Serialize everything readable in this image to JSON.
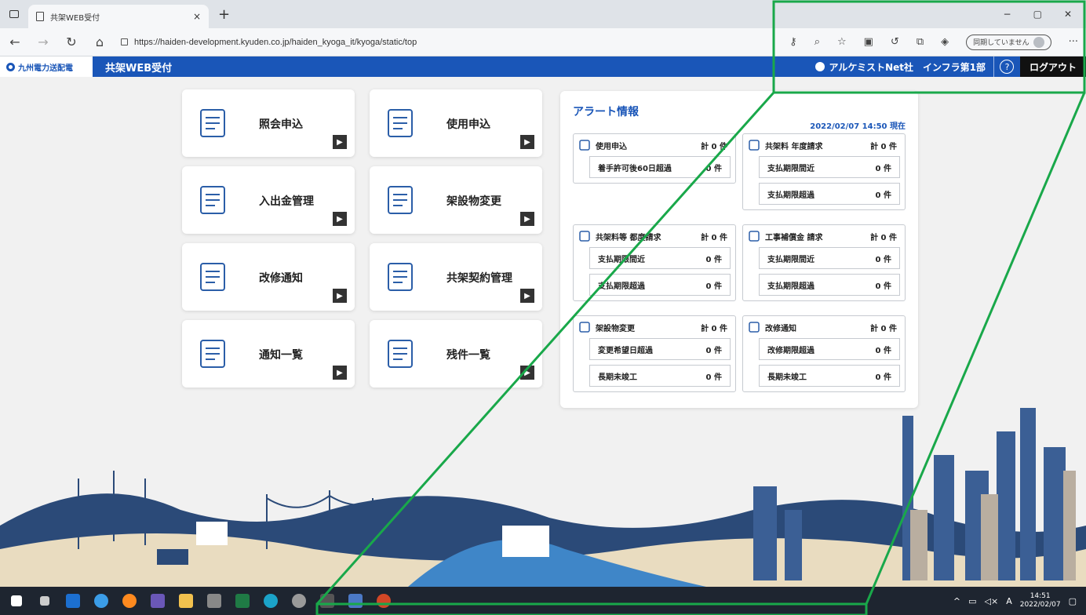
{
  "browser": {
    "tab_title": "共架WEB受付",
    "tab_close": "×",
    "new_tab": "+",
    "url": "https://haiden-development.kyuden.co.jp/haiden_kyoga_it/kyoga/static/top",
    "sync_label": "同期していません",
    "more": "···",
    "min": "−",
    "max": "▢",
    "close": "✕"
  },
  "header": {
    "brand": "九州電力送配電",
    "app_title": "共架WEB受付",
    "user": "アルケミストNet社　インフラ第1部",
    "help": "?",
    "logout": "ログアウト"
  },
  "menu": [
    {
      "label": "照会申込",
      "icon": "clipboard-pen-icon"
    },
    {
      "label": "使用申込",
      "icon": "checklist-icon"
    },
    {
      "label": "入出金管理",
      "icon": "yen-hand-icon"
    },
    {
      "label": "架設物変更",
      "icon": "pole-icon"
    },
    {
      "label": "改修通知",
      "icon": "repair-notice-icon"
    },
    {
      "label": "共架契約管理",
      "icon": "handshake-icon"
    },
    {
      "label": "通知一覧",
      "icon": "bell-info-icon"
    },
    {
      "label": "残件一覧",
      "icon": "list-thumb-icon"
    }
  ],
  "arrow_glyph": "▶",
  "alerts": {
    "title": "アラート情報",
    "timestamp": "2022/02/07 14:50 現在",
    "groups": [
      {
        "name": "使用申込",
        "total": "計 0 件",
        "rows": [
          {
            "name": "着手許可後60日超過",
            "count": "0 件"
          }
        ]
      },
      {
        "name": "共架料 年度請求",
        "total": "計 0 件",
        "rows": [
          {
            "name": "支払期限間近",
            "count": "0 件"
          },
          {
            "name": "支払期限超過",
            "count": "0 件"
          }
        ]
      },
      {
        "name": "共架料等 都度請求",
        "total": "計 0 件",
        "rows": [
          {
            "name": "支払期限間近",
            "count": "0 件"
          },
          {
            "name": "支払期限超過",
            "count": "0 件"
          }
        ]
      },
      {
        "name": "工事補償金 請求",
        "total": "計 0 件",
        "rows": [
          {
            "name": "支払期限間近",
            "count": "0 件"
          },
          {
            "name": "支払期限超過",
            "count": "0 件"
          }
        ]
      },
      {
        "name": "架設物変更",
        "total": "計 0 件",
        "rows": [
          {
            "name": "変更希望日超過",
            "count": "0 件"
          },
          {
            "name": "長期未竣工",
            "count": "0 件"
          }
        ]
      },
      {
        "name": "改修通知",
        "total": "計 0 件",
        "rows": [
          {
            "name": "改修期限超過",
            "count": "0 件"
          },
          {
            "name": "長期未竣工",
            "count": "0 件"
          }
        ]
      }
    ]
  },
  "taskbar": {
    "time": "14:51",
    "date": "2022/02/07",
    "ime": "A"
  },
  "colors": {
    "brand_blue": "#1a56b8",
    "highlight_green": "#19a84a"
  }
}
